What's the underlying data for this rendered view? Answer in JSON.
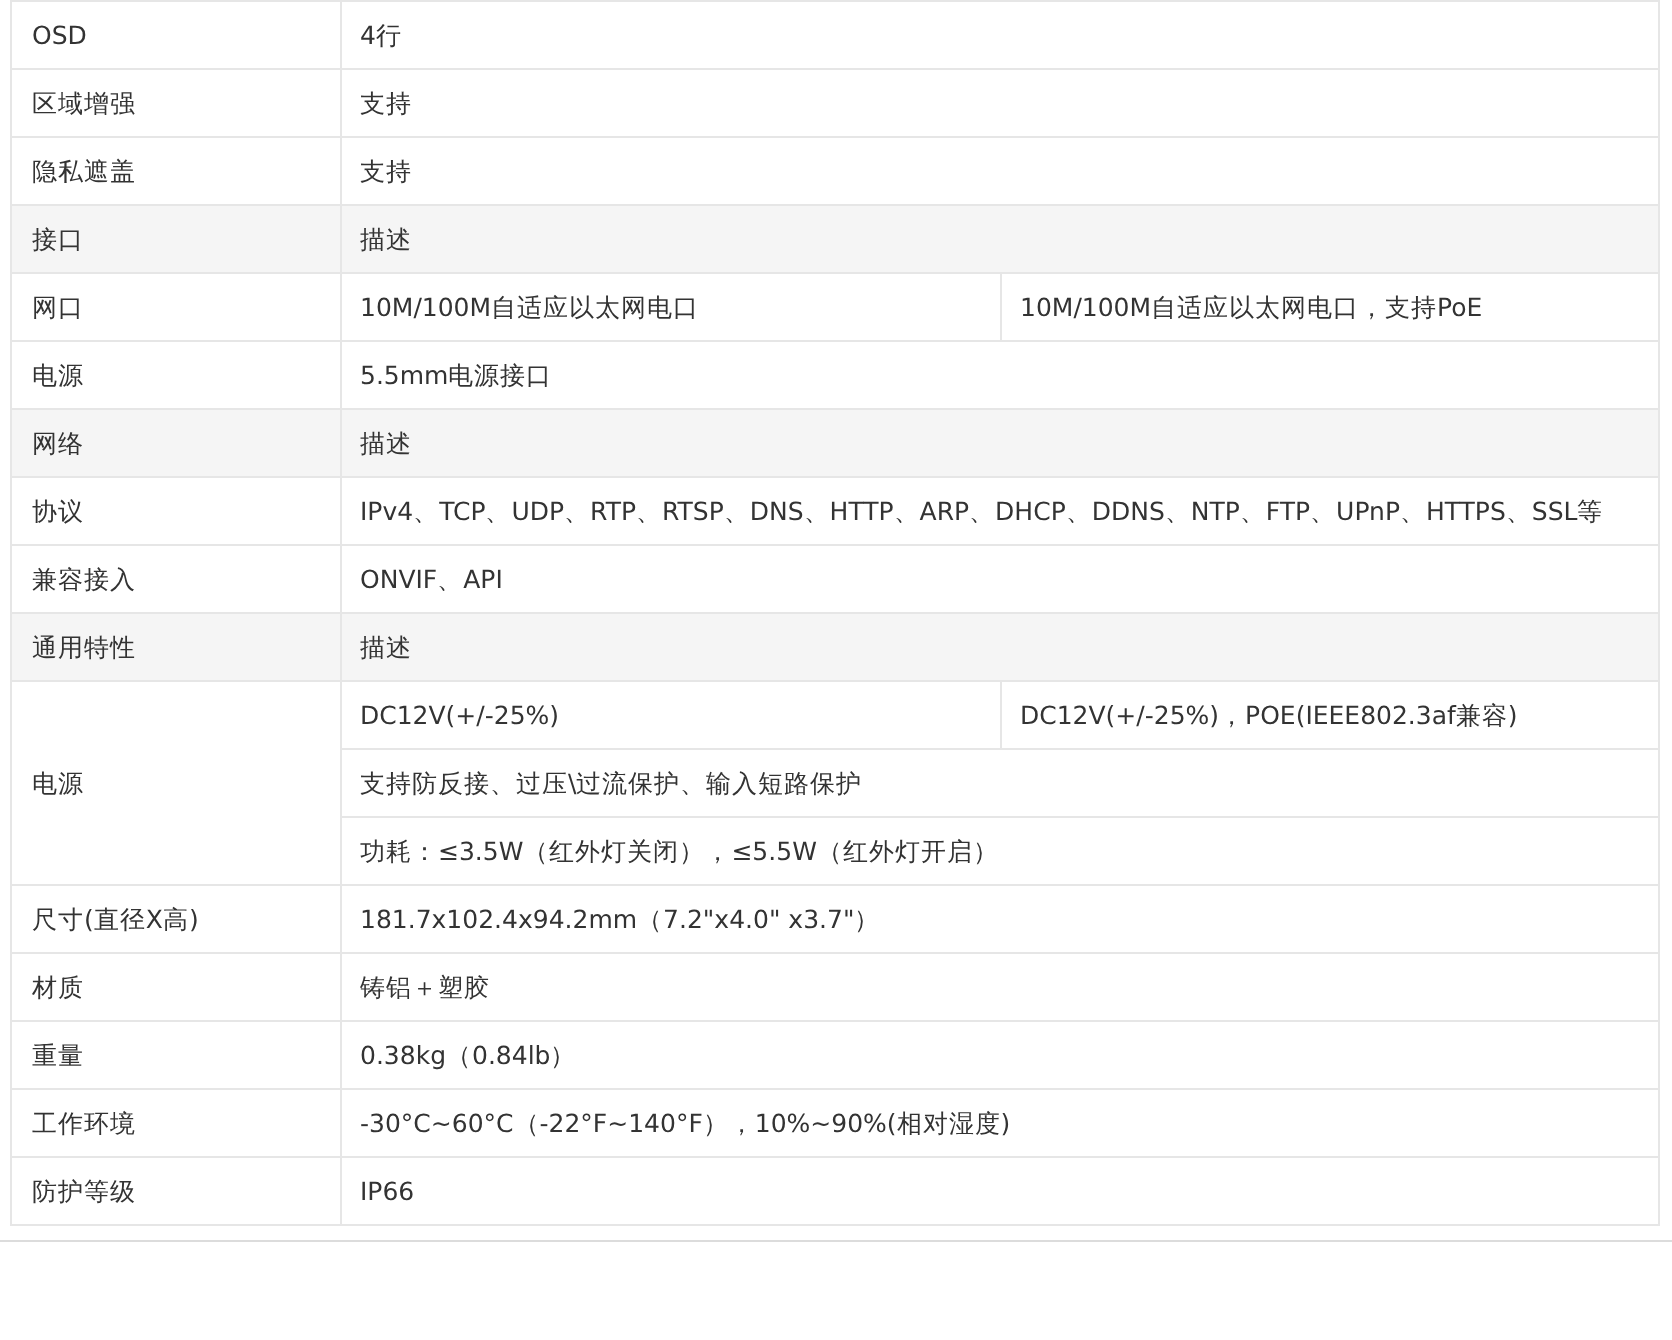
{
  "table": {
    "rows": [
      {
        "kind": "spec",
        "label": "OSD",
        "lines": [
          [
            "4行"
          ]
        ]
      },
      {
        "kind": "spec",
        "label": "区域增强",
        "lines": [
          [
            "支持"
          ]
        ]
      },
      {
        "kind": "spec",
        "label": "隐私遮盖",
        "lines": [
          [
            "支持"
          ]
        ]
      },
      {
        "kind": "section",
        "label": "接口",
        "lines": [
          [
            "描述"
          ]
        ]
      },
      {
        "kind": "spec",
        "label": "网口",
        "lines": [
          [
            "10M/100M自适应以太网电口",
            "10M/100M自适应以太网电口，支持PoE"
          ]
        ]
      },
      {
        "kind": "spec",
        "label": "电源",
        "lines": [
          [
            "5.5mm电源接口"
          ]
        ]
      },
      {
        "kind": "section",
        "label": "网络",
        "lines": [
          [
            "描述"
          ]
        ]
      },
      {
        "kind": "spec",
        "label": "协议",
        "lines": [
          [
            "IPv4、TCP、UDP、RTP、RTSP、DNS、HTTP、ARP、DHCP、DDNS、NTP、FTP、UPnP、HTTPS、SSL等"
          ]
        ]
      },
      {
        "kind": "spec",
        "label": "兼容接入",
        "lines": [
          [
            "ONVIF、API"
          ]
        ]
      },
      {
        "kind": "section",
        "label": "通用特性",
        "lines": [
          [
            "描述"
          ]
        ]
      },
      {
        "kind": "spec",
        "label": "电源",
        "lines": [
          [
            "DC12V(+/-25%)",
            "DC12V(+/-25%)，POE(IEEE802.3af兼容)"
          ],
          [
            "支持防反接、过压\\过流保护、输入短路保护"
          ],
          [
            "功耗：≤3.5W（红外灯关闭），≤5.5W（红外灯开启）"
          ]
        ]
      },
      {
        "kind": "spec",
        "label": "尺寸(直径X高)",
        "lines": [
          [
            "181.7x102.4x94.2mm（7.2\"x4.0\" x3.7\"）"
          ]
        ]
      },
      {
        "kind": "spec",
        "label": "材质",
        "lines": [
          [
            "铸铝＋塑胶"
          ]
        ]
      },
      {
        "kind": "spec",
        "label": "重量",
        "lines": [
          [
            "0.38kg（0.84lb）"
          ]
        ]
      },
      {
        "kind": "spec",
        "label": "工作环境",
        "lines": [
          [
            "-30°C~60°C（-22°F~140°F），10%~90%(相对湿度)"
          ]
        ]
      },
      {
        "kind": "spec",
        "label": "防护等级",
        "lines": [
          [
            "IP66"
          ]
        ]
      }
    ]
  }
}
